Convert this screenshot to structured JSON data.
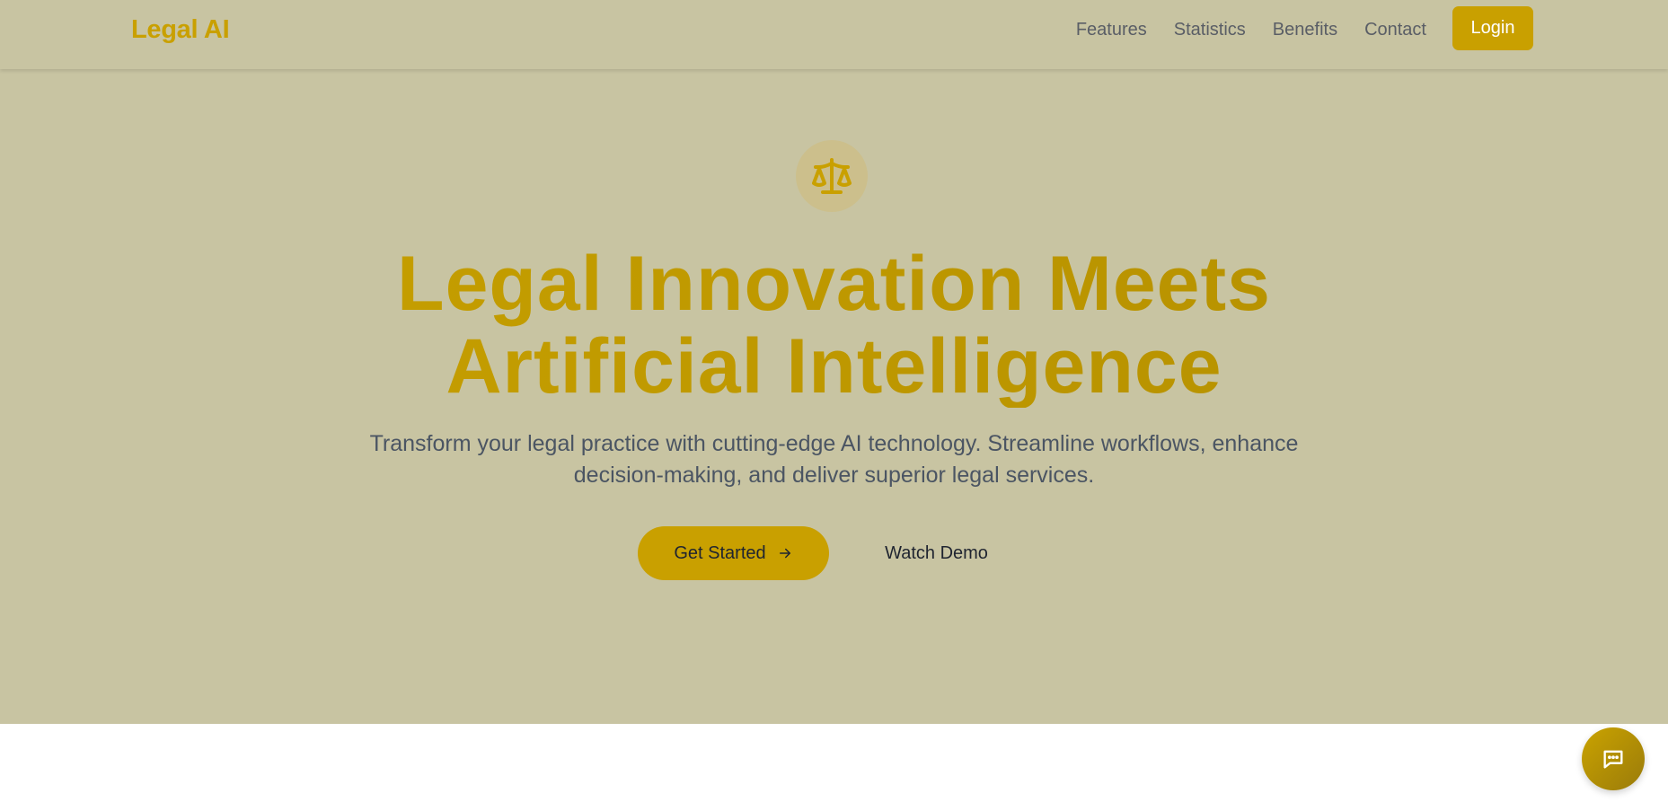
{
  "brand": {
    "logo_text": "Legal AI",
    "accent_color": "#c9a000",
    "hero_bg_color": "#c8c4a2"
  },
  "nav": {
    "links": [
      {
        "label": "Features"
      },
      {
        "label": "Statistics"
      },
      {
        "label": "Benefits"
      },
      {
        "label": "Contact"
      }
    ],
    "login_label": "Login"
  },
  "hero": {
    "icon": "scale-balance-icon",
    "headline_line1": "Legal Innovation Meets",
    "headline_line2": "Artificial Intelligence",
    "subtitle": "Transform your legal practice with cutting-edge AI technology. Streamline workflows, enhance decision-making, and deliver superior legal services.",
    "primary_cta": "Get Started",
    "primary_cta_icon": "arrow-right-icon",
    "secondary_cta": "Watch Demo"
  },
  "chat": {
    "icon": "chat-bubble-icon"
  }
}
